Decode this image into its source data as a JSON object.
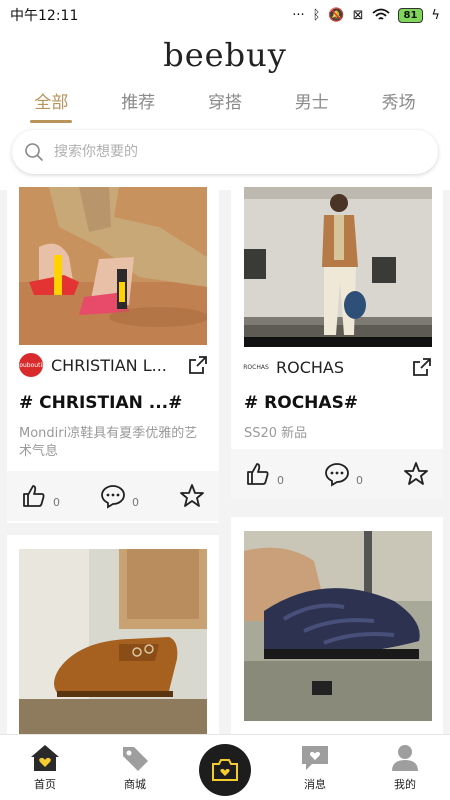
{
  "status_bar": {
    "time": "中午12:11",
    "battery": "81"
  },
  "header": {
    "logo": "beebuy"
  },
  "tabs": [
    {
      "label": "全部",
      "active": true
    },
    {
      "label": "推荐",
      "active": false
    },
    {
      "label": "穿搭",
      "active": false
    },
    {
      "label": "男士",
      "active": false
    },
    {
      "label": "秀场",
      "active": false
    }
  ],
  "search": {
    "placeholder": "搜索你想要的"
  },
  "feed": {
    "cards": [
      {
        "brand_logo_text": "Louboutin",
        "brand": "CHRISTIAN L...",
        "tag": "# CHRISTIAN ...#",
        "description": "Mondiri凉鞋具有夏季优雅的艺术气息",
        "likes": "0",
        "comments": "0"
      },
      {
        "brand_logo_text": "ROCHAS",
        "brand": "ROCHAS",
        "tag": "# ROCHAS#",
        "description": "SS20 新品",
        "likes": "0",
        "comments": "0"
      }
    ]
  },
  "bottom_nav": {
    "home": "首页",
    "mall": "商城",
    "messages": "消息",
    "mine": "我的"
  },
  "colors": {
    "accent": "#b9935a",
    "nav_icon": "#9e9e9e",
    "home_heart": "#f5cc2f"
  }
}
